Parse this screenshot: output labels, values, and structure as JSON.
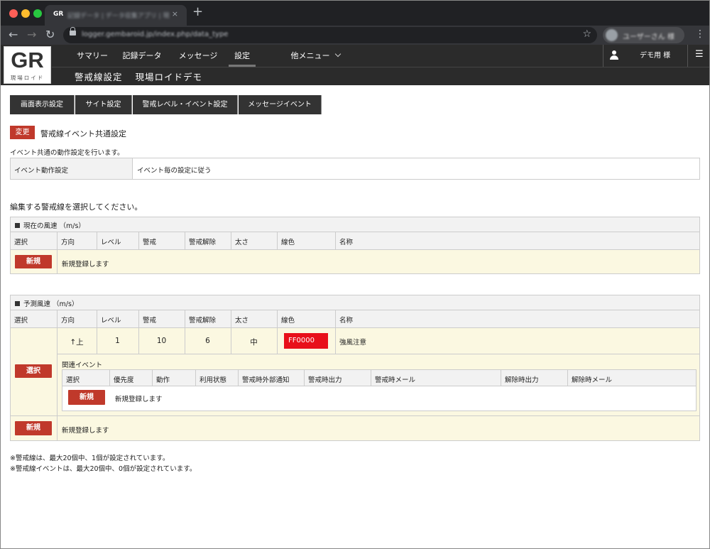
{
  "browser": {
    "tab_favicon": "GR",
    "tab_title": "記録データ | データ収集アプリ | 現",
    "tab_close": "×",
    "new_tab": "+",
    "url": "logger.gembaroid.jp/index.php/data_type",
    "profile_name": "ユーザーさん 様",
    "back": "←",
    "forward": "→",
    "reload": "↻",
    "star": "☆",
    "menu": "⋮"
  },
  "app": {
    "logo_text": "GR",
    "logo_sub": "現場ロイド",
    "nav": [
      {
        "label": "サマリー"
      },
      {
        "label": "記録データ"
      },
      {
        "label": "メッセージ"
      },
      {
        "label": "設定"
      },
      {
        "label": "他メニュー"
      }
    ],
    "user_label": "デモ用 様",
    "menu_icon": "☰",
    "page_title": "警戒線設定",
    "site_name": "現場ロイドデモ"
  },
  "settings_tabs": [
    "画面表示設定",
    "サイト設定",
    "警戒レベル・イベント設定",
    "メッセージイベント"
  ],
  "common": {
    "badge": "変更",
    "title": "警戒線イベント共通設定",
    "desc": "イベント共通の動作設定を行います。",
    "row_label": "イベント動作設定",
    "row_value": "イベント毎の設定に従う"
  },
  "select_prompt": "編集する警戒線を選択してください。",
  "columns": [
    "選択",
    "方向",
    "レベル",
    "警戒",
    "警戒解除",
    "太さ",
    "線色",
    "名称"
  ],
  "section1": {
    "title": "現在の風速 （m/s）",
    "new_btn": "新規",
    "new_text": "新規登録します"
  },
  "section2": {
    "title": "予測風速 （m/s）",
    "row": {
      "select_btn": "選択",
      "direction": "↑上",
      "level": "1",
      "alert": "10",
      "release": "6",
      "width": "中",
      "color": "FF0000",
      "name": "強風注意"
    },
    "related": {
      "title": "関連イベント",
      "columns": [
        "選択",
        "優先度",
        "動作",
        "利用状態",
        "警戒時外部通知",
        "警戒時出力",
        "警戒時メール",
        "解除時出力",
        "解除時メール"
      ],
      "new_btn": "新規",
      "new_text": "新規登録します"
    },
    "new_btn": "新規",
    "new_text": "新規登録します"
  },
  "notes": [
    "※警戒線は、最大20個中、1個が設定されています。",
    "※警戒線イベントは、最大20個中、0個が設定されています。"
  ],
  "colors": {
    "accent_red": "#c0392b",
    "line_color": "#e8101a",
    "header_bg": "#2b2b2b",
    "cream": "#fbf8e1"
  }
}
